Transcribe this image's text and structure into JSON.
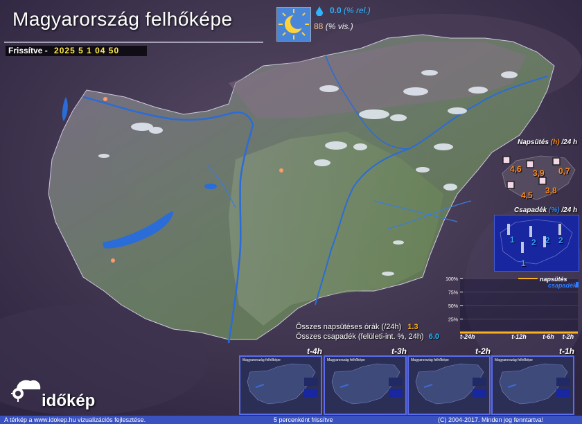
{
  "header": {
    "title": "Magyarország felhőképe",
    "updated_label": "Frissítve -",
    "updated_value": "2025 5 1  04 50"
  },
  "weather_now": {
    "icon": "sun-moon-icon",
    "rel_value": "0.0",
    "rel_unit": "(% rel.)",
    "vis_value": "88",
    "vis_unit": "(% vis.)"
  },
  "sunshine_panel": {
    "title_prefix": "Napsütés",
    "title_unit": "(h)",
    "title_suffix": "/24 h",
    "values": [
      "4,6",
      "3,9",
      "0,7",
      "4,5",
      "3,8"
    ]
  },
  "precip_panel": {
    "title_prefix": "Csapadék",
    "title_unit": "(%)",
    "title_suffix": "/24 h",
    "values": [
      "1",
      "2",
      "2",
      "1",
      "2"
    ]
  },
  "summary": {
    "sun_label": "Összes napsütéses órák (/24h)",
    "sun_value": "1.3",
    "rain_label": "Összes csapadék (felületi-int. %, 24h)",
    "rain_value": "6.0"
  },
  "chart_data": {
    "type": "line",
    "y_ticks": [
      "100%",
      "75%",
      "50%",
      "25%"
    ],
    "x_ticks": [
      "t-24h",
      "t-12h",
      "t-6h",
      "t-2h"
    ],
    "legend": [
      {
        "name": "napsütés",
        "color": "#ffb020"
      },
      {
        "name": "csapadék",
        "color": "#2f7cff"
      }
    ],
    "ylim": [
      0,
      100
    ],
    "grid": true,
    "legend_placement": "top-right"
  },
  "history": [
    {
      "label": "t-4h"
    },
    {
      "label": "t-3h"
    },
    {
      "label": "t-2h"
    },
    {
      "label": "t-1h"
    }
  ],
  "thumb_title": "Magyarország felhőképe",
  "logo": {
    "text": "időkép",
    "icon": "cloud-sun-logo-icon"
  },
  "footer": {
    "left": "A térkép a www.idokep.hu vizualizációs fejlesztése.",
    "center": "5 percenként frissítve",
    "right": "(C) 2004-2017. Minden jog fenntartva!"
  },
  "colors": {
    "background": "#3a2f4a",
    "country_fill": "#5f7f50",
    "water": "#2a6cd8",
    "accent_orange": "#ff8c1a",
    "accent_blue": "#2fb4ff",
    "footer_bg": "#3a52c0"
  }
}
